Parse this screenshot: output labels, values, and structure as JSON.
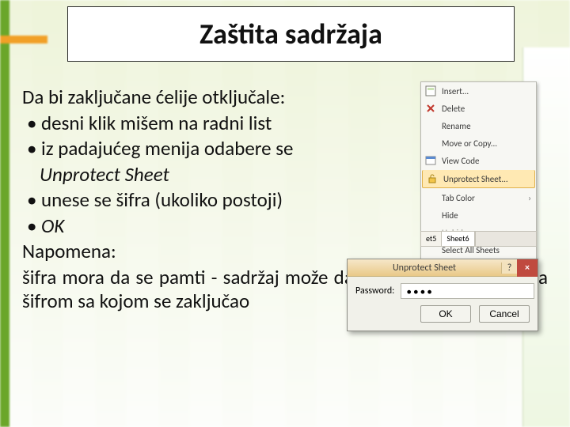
{
  "title": "Zaštita sadržaja",
  "intro": "Da bi zaključane ćelije otključale:",
  "bullets": [
    "desni klik mišem na radni list",
    "iz padajućeg menija odabere se",
    "unese se šifra (ukoliko postoji)",
    "OK"
  ],
  "bullet_indent": "Unprotect Sheet",
  "note_label": "Napomena:",
  "note_body": "šifra mora da se pamti - sadržaj može da se otključa isključivo sa šifrom sa kojom se zaključao",
  "ctx": {
    "items": [
      {
        "icon": "insert-icon",
        "label": "Insert...",
        "interactable": true
      },
      {
        "icon": "delete-icon",
        "label": "Delete",
        "interactable": true
      },
      {
        "icon": "rename-icon",
        "label": "Rename",
        "interactable": true
      },
      {
        "icon": "move-icon",
        "label": "Move or Copy...",
        "interactable": true
      },
      {
        "icon": "code-icon",
        "label": "View Code",
        "interactable": true
      },
      {
        "icon": "unprotect-icon",
        "label": "Unprotect Sheet...",
        "interactable": true,
        "selected": true
      },
      {
        "icon": "tabcolor-icon",
        "label": "Tab Color",
        "interactable": true,
        "submenu": true
      },
      {
        "icon": "hide-icon",
        "label": "Hide",
        "interactable": true
      },
      {
        "icon": "unhide-icon",
        "label": "Unhide...",
        "interactable": false
      },
      {
        "icon": "selectall-icon",
        "label": "Select All Sheets",
        "interactable": true
      }
    ]
  },
  "tabs": {
    "items": [
      "et5",
      "Sheet6"
    ],
    "active_index": 1,
    "scroll_hint": "▸"
  },
  "dialog": {
    "title": "Unprotect Sheet",
    "help": "?",
    "close": "×",
    "password_label": "Password:",
    "password_value": "••••",
    "ok": "OK",
    "cancel": "Cancel"
  }
}
